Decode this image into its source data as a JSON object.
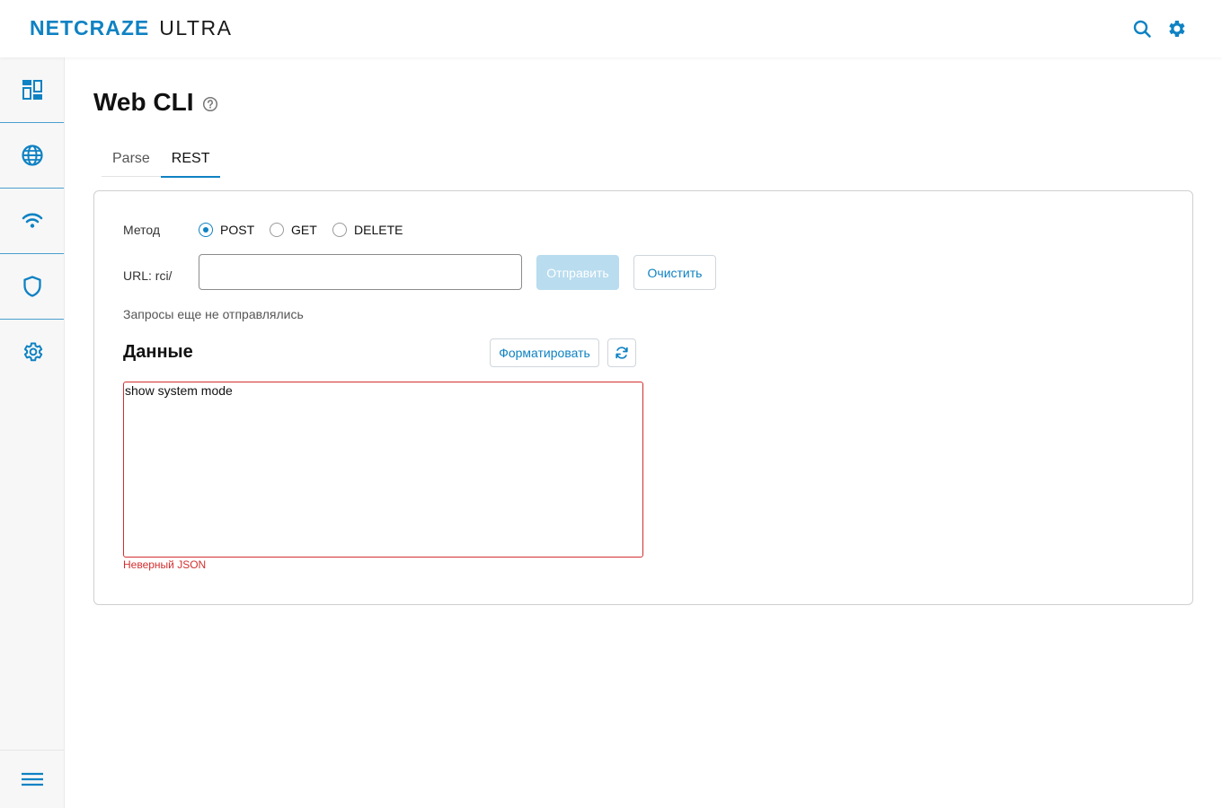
{
  "header": {
    "brand": "NETCRAZE",
    "product": "ULTRA",
    "icons": [
      "search-icon",
      "settings-gear-icon"
    ],
    "accent_color": "#0f82c3"
  },
  "sidebar": {
    "items": [
      {
        "name": "dashboard",
        "icon": "dashboard-icon"
      },
      {
        "name": "internet",
        "icon": "globe-icon"
      },
      {
        "name": "wifi",
        "icon": "wifi-icon"
      },
      {
        "name": "security",
        "icon": "shield-icon"
      },
      {
        "name": "system",
        "icon": "gear-icon"
      }
    ],
    "bottom_icon": "menu-icon"
  },
  "page": {
    "title": "Web CLI",
    "help_icon": "help-circle-icon"
  },
  "tabs": [
    {
      "label": "Parse",
      "active": false
    },
    {
      "label": "REST",
      "active": true
    }
  ],
  "form": {
    "method_label": "Метод",
    "methods": [
      {
        "label": "POST",
        "selected": true
      },
      {
        "label": "GET",
        "selected": false
      },
      {
        "label": "DELETE",
        "selected": false
      }
    ],
    "url_label": "URL: rci/",
    "url_value": "",
    "send_label": "Отправить",
    "clear_label": "Очистить",
    "status_text": "Запросы еще не отправлялись"
  },
  "data_section": {
    "title": "Данные",
    "format_label": "Форматировать",
    "refresh_icon": "refresh-icon",
    "content": "show system mode",
    "error": "Неверный JSON",
    "error_color": "#d32f2f"
  }
}
